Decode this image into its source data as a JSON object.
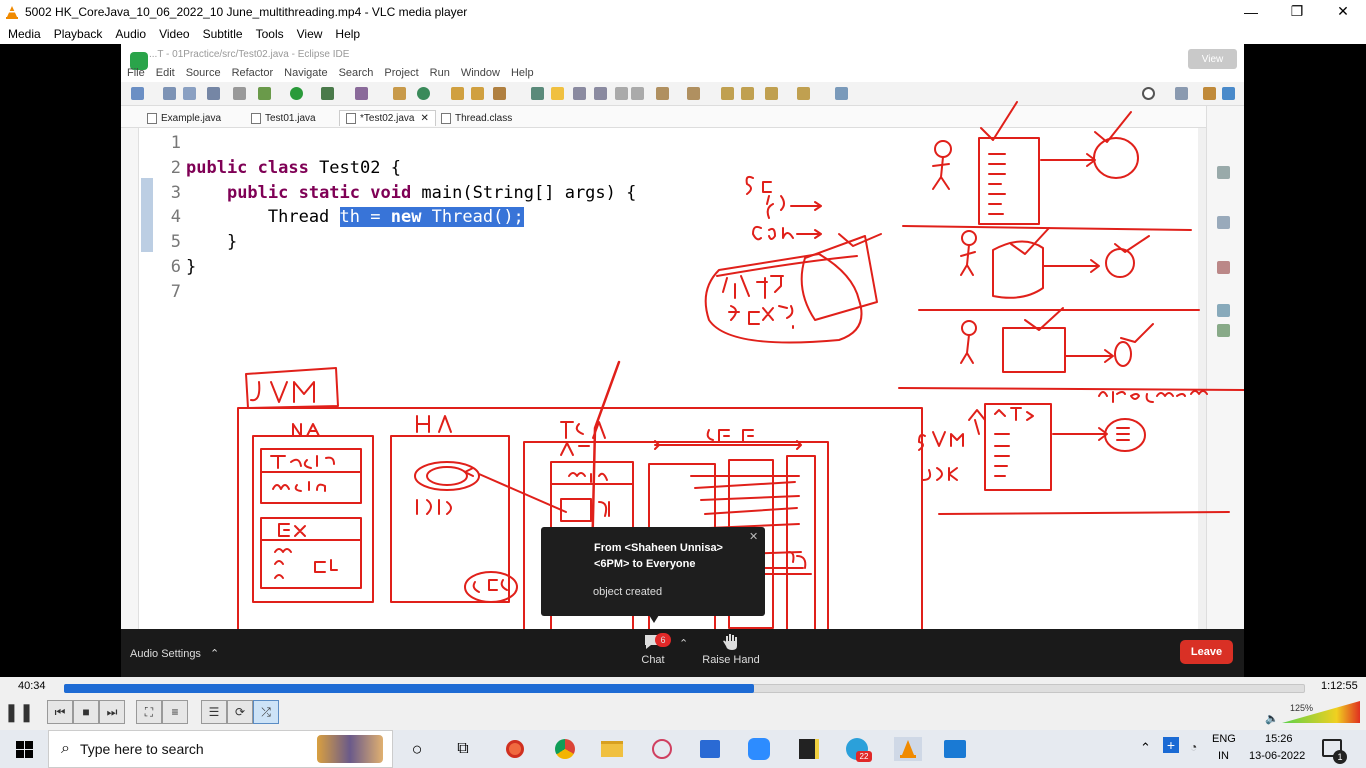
{
  "window": {
    "title": "5002 HK_CoreJava_10_06_2022_10 June_multithreading.mp4 - VLC media player",
    "minimize": "—",
    "maximize": "❐",
    "close": "✕"
  },
  "menu": [
    "Media",
    "Playback",
    "Audio",
    "Video",
    "Subtitle",
    "Tools",
    "View",
    "Help"
  ],
  "eclipse": {
    "title": "...T - 01Practice/src/Test02.java - Eclipse IDE",
    "view_label": "View",
    "menu": [
      "File",
      "Edit",
      "Source",
      "Refactor",
      "Navigate",
      "Search",
      "Project",
      "Run",
      "Window",
      "Help"
    ],
    "tabs": [
      "Example.java",
      "Test01.java",
      "*Test02.java",
      "Thread.class"
    ],
    "line_numbers": [
      "1",
      "2",
      "3",
      "4",
      "5",
      "6",
      "7"
    ],
    "code": {
      "l2_kw": "public class",
      "l2_rest": " Test02 {",
      "l3_indent": "    ",
      "l3_kw": "public static void",
      "l3_rest": " main(String[] args) {",
      "l4_indent": "        Thread ",
      "l4_sel_a": "th = ",
      "l4_sel_kw": "new",
      "l4_sel_b": " Thread();",
      "l5": "    }",
      "l6": "}"
    }
  },
  "zoom": {
    "audio_settings": "Audio Settings",
    "chat_label": "Chat",
    "chat_badge": "6",
    "raise_hand_label": "Raise Hand",
    "leave_label": "Leave",
    "popup_from": "From <Shaheen Unnisa>",
    "popup_to": "<6PM> to Everyone",
    "popup_message": "object created"
  },
  "player": {
    "elapsed": "40:34",
    "total": "1:12:55",
    "progress_fraction": 0.556,
    "volume": "125%"
  },
  "taskbar": {
    "search_placeholder": "Type here to search",
    "lang_top": "ENG",
    "lang_bottom": "IN",
    "time": "15:26",
    "date": "13-06-2022",
    "telegram_badge": "22",
    "notif_badge": "1"
  },
  "colors": {
    "ink": "#e0201a",
    "vlc_progress": "#1e6bd4",
    "zoom_leave": "#d93025",
    "selection": "#3874d8"
  }
}
